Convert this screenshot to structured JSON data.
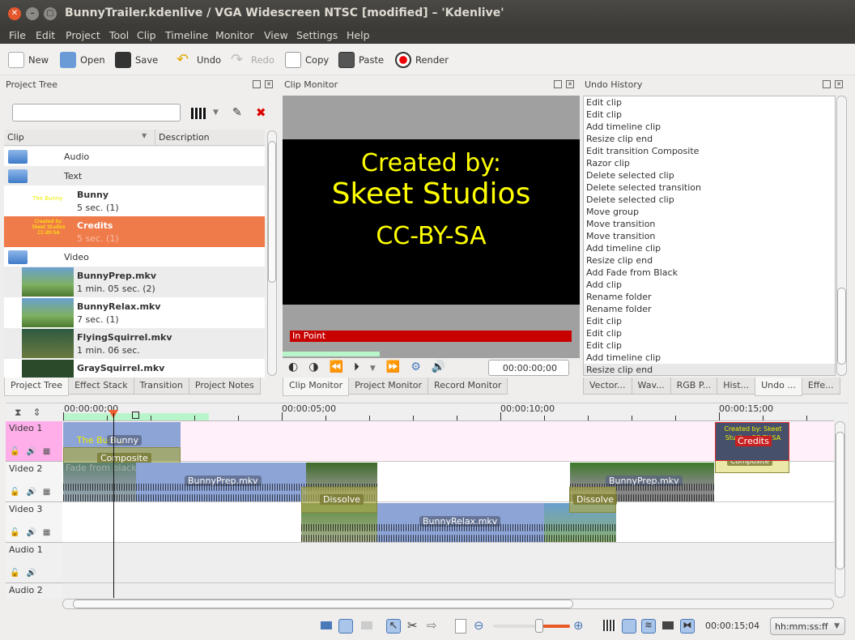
{
  "window": {
    "title": "BunnyTrailer.kdenlive / VGA Widescreen NTSC [modified] – 'Kdenlive'"
  },
  "menu": [
    "File",
    "Edit",
    "Project",
    "Tool",
    "Clip",
    "Timeline",
    "Monitor",
    "View",
    "Settings",
    "Help"
  ],
  "toolbar": {
    "new": "New",
    "open": "Open",
    "save": "Save",
    "undo": "Undo",
    "redo": "Redo",
    "copy": "Copy",
    "paste": "Paste",
    "render": "Render"
  },
  "project_tree": {
    "title": "Project Tree",
    "search_value": "",
    "columns": [
      "Clip",
      "Description"
    ],
    "rows": [
      {
        "type": "folder",
        "name": "Audio"
      },
      {
        "type": "folder",
        "name": "Text"
      },
      {
        "type": "clip",
        "name": "Bunny",
        "info": "5 sec. (1)",
        "thumb_text": "The Bunny"
      },
      {
        "type": "clip",
        "name": "Credits",
        "info": "5 sec. (1)",
        "thumb_text": "Created by: Skeet Studios CC-BY-SA",
        "selected": true
      },
      {
        "type": "folder",
        "name": "Video"
      },
      {
        "type": "clip",
        "name": "BunnyPrep.mkv",
        "info": "1 min. 05 sec. (2)"
      },
      {
        "type": "clip",
        "name": "BunnyRelax.mkv",
        "info": "7 sec. (1)"
      },
      {
        "type": "clip",
        "name": "FlyingSquirrel.mkv",
        "info": "1 min. 06 sec."
      },
      {
        "type": "clip",
        "name": "GraySquirrel.mkv",
        "info": ""
      }
    ],
    "tabs": [
      "Project Tree",
      "Effect Stack",
      "Transition",
      "Project Notes"
    ]
  },
  "clip_monitor": {
    "title": "Clip Monitor",
    "line1": "Created by:",
    "line2": "Skeet Studios",
    "line3": "CC-BY-SA",
    "in_point": "In Point",
    "timecode": "00:00:00;00",
    "tabs": [
      "Clip Monitor",
      "Project Monitor",
      "Record Monitor"
    ]
  },
  "undo_history": {
    "title": "Undo History",
    "items": [
      "Edit clip",
      "Edit clip",
      "Add timeline clip",
      "Resize clip end",
      "Edit transition Composite",
      "Razor clip",
      "Delete selected clip",
      "Delete selected transition",
      "Delete selected clip",
      "Move group",
      "Move transition",
      "Move transition",
      "Add timeline clip",
      "Resize clip end",
      "Add Fade from Black",
      "Add clip",
      "Rename folder",
      "Rename folder",
      "Edit clip",
      "Edit clip",
      "Edit clip",
      "Add timeline clip",
      "Resize clip end"
    ],
    "tabs": [
      "Vector...",
      "Wav...",
      "RGB P...",
      "Hist...",
      "Undo ...",
      "Effe..."
    ]
  },
  "timeline": {
    "ruler": [
      "00:00:00;00",
      "00:00:05;00",
      "00:00:10;00",
      "00:00:15;00"
    ],
    "tracks": [
      "Video 1",
      "Video 2",
      "Video 3",
      "Audio 1",
      "Audio 2"
    ],
    "clips": {
      "bunny_title": "The Bunny",
      "bunny_label": "Bunny",
      "composite": "Composite",
      "fade": "Fade from black",
      "bunnyprep": "BunnyPrep.mkv",
      "bunnyprep2": "BunnyPrep.mkv",
      "dissolve1": "Dissolve",
      "dissolve2": "Dissolve",
      "bunnyrelax": "BunnyRelax.mkv",
      "credits": "Credits",
      "credits_text": "Created by: Skeet Studios CC-BY-SA",
      "composite2": "Composite"
    },
    "playhead": "00:00:01;04"
  },
  "statusbar": {
    "timecode": "00:00:15;04",
    "format": "hh:mm:ss:ff",
    "zoom_fraction": 0.6
  },
  "colors": {
    "selection": "#ef7a4a",
    "titlebar": "#3c3b37",
    "clip": "#8da4d6",
    "video1_header": "#ffaee9",
    "in_point": "#cc0000",
    "title_text": "#ffff00"
  }
}
